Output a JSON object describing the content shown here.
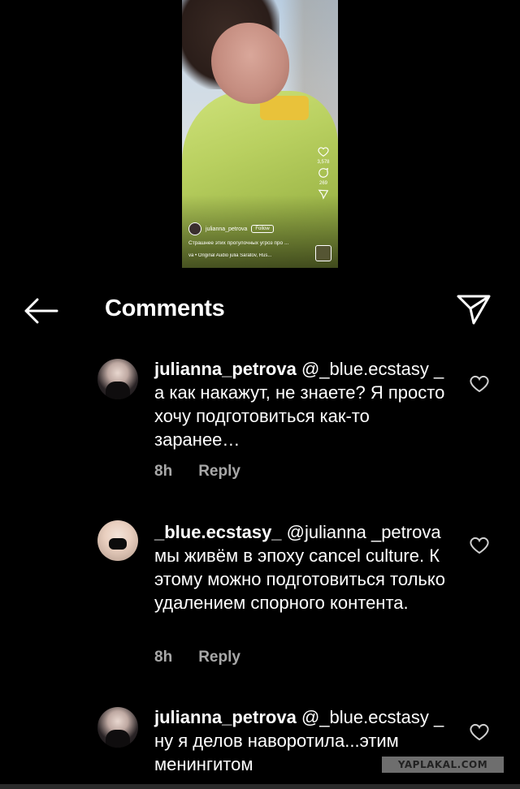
{
  "video": {
    "username": "julianna_petrova",
    "follow_label": "Follow",
    "likes": "3,578",
    "comments": "269",
    "caption": "Страшнее этих прогулочных угроз про ...",
    "meta": "va • Original Audio  julia  Saratov, Rus..."
  },
  "header": {
    "title": "Comments"
  },
  "comments": [
    {
      "username": "julianna_petrova",
      "mention": "@_blue.ecstasy",
      "text": "_ а как накажут, не знаете? Я просто хочу подготовиться как-то заранее…",
      "time": "8h",
      "reply": "Reply"
    },
    {
      "username": "_blue.ecstasy_",
      "mention": "@julianna _petrova",
      "text": "мы живём в эпоху cancel culture. К этому можно подготовиться только удалением спорного контента.",
      "time": "8h",
      "reply": "Reply"
    },
    {
      "username": "julianna_petrova",
      "mention": "@_blue.ecstasy",
      "text": "_ ну я делов наворотила...этим менингитом"
    }
  ],
  "watermark": "YAPLAKAL.COM"
}
